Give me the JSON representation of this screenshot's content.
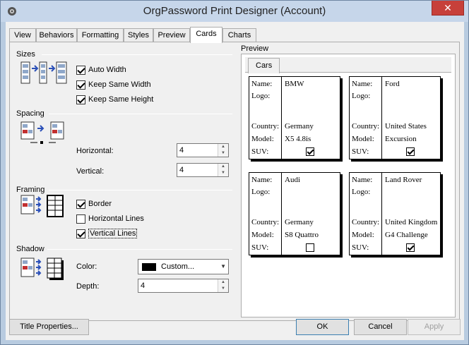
{
  "window": {
    "title": "OrgPassword Print Designer (Account)",
    "close_glyph": "✕"
  },
  "tabs": [
    "View",
    "Behaviors",
    "Formatting",
    "Styles",
    "Preview",
    "Cards",
    "Charts"
  ],
  "sizes": {
    "label": "Sizes",
    "auto_width": {
      "label": "Auto Width",
      "checked": true
    },
    "keep_same_width": {
      "label": "Keep Same Width",
      "checked": true
    },
    "keep_same_height": {
      "label": "Keep Same Height",
      "checked": true
    }
  },
  "spacing": {
    "label": "Spacing",
    "horizontal_label": "Horizontal:",
    "horizontal_value": "4",
    "vertical_label": "Vertical:",
    "vertical_value": "4"
  },
  "framing": {
    "label": "Framing",
    "border": {
      "label": "Border",
      "checked": true
    },
    "horizontal_lines": {
      "label": "Horizontal Lines",
      "checked": false
    },
    "vertical_lines": {
      "label": "Vertical Lines",
      "checked": true
    }
  },
  "shadow": {
    "label": "Shadow",
    "color_label": "Color:",
    "color_value": "Custom...",
    "color_swatch": "#000000",
    "depth_label": "Depth:",
    "depth_value": "4"
  },
  "preview": {
    "label": "Preview",
    "tab": "Cars",
    "field_labels": {
      "name": "Name:",
      "logo": "Logo:",
      "country": "Country:",
      "model": "Model:",
      "suv": "SUV:"
    },
    "cards": [
      {
        "name": "BMW",
        "country": "Germany",
        "model": "X5 4.8is",
        "suv": true
      },
      {
        "name": "Ford",
        "country": "United States",
        "model": "Excursion",
        "suv": true
      },
      {
        "name": "Audi",
        "country": "Germany",
        "model": "S8 Quattro",
        "suv": false
      },
      {
        "name": "Land Rover",
        "country": "United Kingdom",
        "model": "G4 Challenge",
        "suv": true
      }
    ]
  },
  "buttons": {
    "title_properties": "Title Properties...",
    "ok": "OK",
    "cancel": "Cancel",
    "apply": "Apply"
  }
}
